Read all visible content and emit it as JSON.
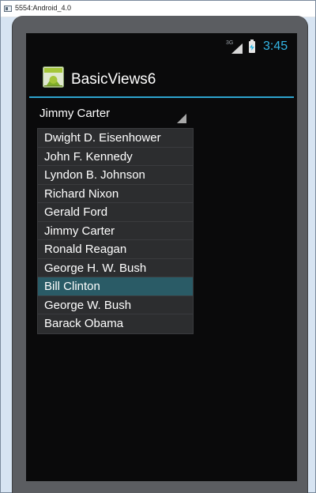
{
  "window": {
    "title": "5554:Android_4.0"
  },
  "status_bar": {
    "network_label": "3G",
    "time": "3:45",
    "accent_color": "#33b5e5"
  },
  "action_bar": {
    "title": "BasicViews6",
    "divider_color": "#2ea4cf"
  },
  "spinner": {
    "selected_value": "Jimmy Carter"
  },
  "dropdown": {
    "items": [
      {
        "label": "Dwight D. Eisenhower"
      },
      {
        "label": "John F. Kennedy"
      },
      {
        "label": "Lyndon B. Johnson"
      },
      {
        "label": "Richard Nixon"
      },
      {
        "label": "Gerald Ford"
      },
      {
        "label": "Jimmy Carter"
      },
      {
        "label": "Ronald Reagan"
      },
      {
        "label": "George H. W. Bush"
      },
      {
        "label": "Bill Clinton"
      },
      {
        "label": "George W. Bush"
      },
      {
        "label": "Barack Obama"
      }
    ],
    "highlighted_label": "Bill Clinton",
    "highlight_color": "#2a5b66"
  },
  "icons": {
    "window_icon": "emulator-window-icon",
    "signal": "cell-signal-icon",
    "battery": "battery-charging-icon",
    "launcher": "android-launcher-icon",
    "spinner_arrow": "spinner-triangle-icon"
  }
}
